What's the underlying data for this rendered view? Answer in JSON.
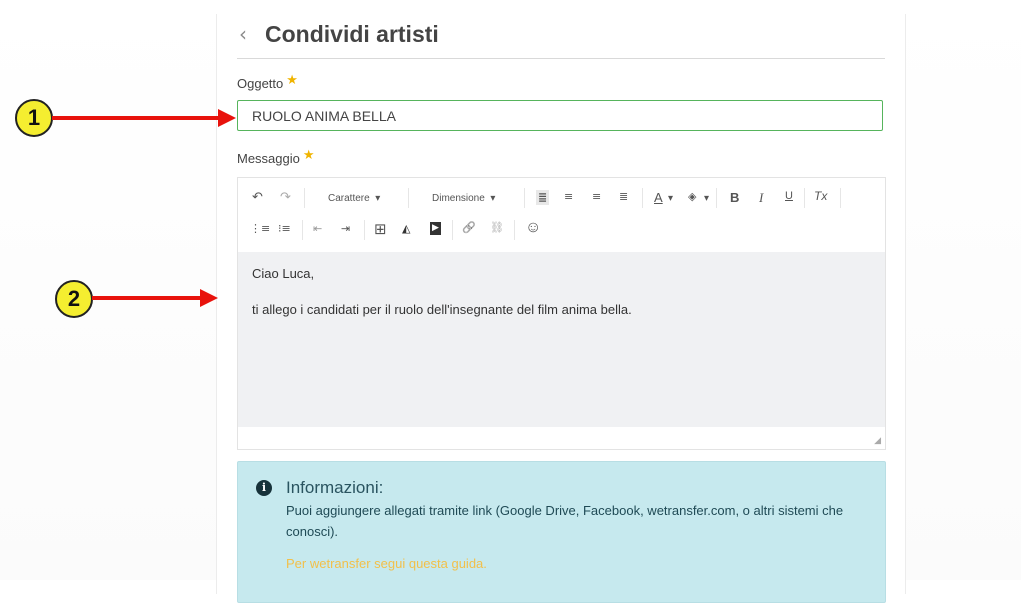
{
  "header": {
    "back_glyph": "‹",
    "title": "Condividi artisti"
  },
  "form": {
    "subject_label": "Oggetto",
    "subject_value": "RUOLO ANIMA BELLA",
    "message_label": "Messaggio",
    "required_star": "★"
  },
  "toolbar": {
    "font_label": "Carattere",
    "size_label": "Dimensione",
    "dropdown_caret": "▾",
    "undo_icon": "↶",
    "redo_icon": "↷",
    "align_left_icon": "≣",
    "align_center_icon": "≡",
    "align_right_icon": "≡",
    "justify_icon": "≣",
    "font_color_icon": "A",
    "bg_color_icon": "◈",
    "bold_icon": "B",
    "italic_icon": "I",
    "underline_icon": "U",
    "clear_format_icon": "Tx",
    "ordered_list_icon": "⋮≡",
    "bullet_list_icon": "⁝≡",
    "outdent_icon": "⇤",
    "indent_icon": "⇥",
    "table_icon": "⊞",
    "image_icon": "◭",
    "video_icon": "▶",
    "link_icon": "🔗",
    "unlink_icon": "⛓",
    "emoji_icon": "☺"
  },
  "message": {
    "line1": "Ciao Luca,",
    "line2": "ti allego i candidati per il ruolo dell'insegnante del film anima bella."
  },
  "info": {
    "icon": "i",
    "title": "Informazioni:",
    "text": "Puoi aggiungere allegati tramite link (Google Drive, Facebook, wetransfer.com, o altri sistemi che conosci).",
    "link": "Per wetransfer segui questa guida."
  },
  "annotations": {
    "badge1": "1",
    "badge2": "2"
  },
  "colors": {
    "accent_green": "#56b45c",
    "arrow_red": "#e8120c",
    "badge_yellow": "#f5ee30",
    "info_bg": "#c6e9ee",
    "link_yellow": "#f2c04a"
  }
}
